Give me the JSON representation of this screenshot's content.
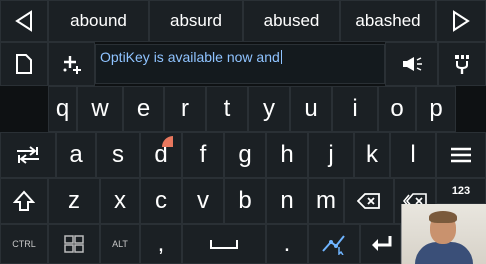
{
  "suggestions": [
    "abound",
    "absurd",
    "abused",
    "abashed"
  ],
  "scratchpad": {
    "text": "OptiKey is available now and"
  },
  "keyboard": {
    "row1": [
      "q",
      "w",
      "e",
      "r",
      "t",
      "y",
      "u",
      "i",
      "o",
      "p"
    ],
    "row2": [
      "a",
      "s",
      "d",
      "f",
      "g",
      "h",
      "j",
      "k",
      "l"
    ],
    "row3": [
      "z",
      "x",
      "c",
      "v",
      "b",
      "n",
      "m"
    ],
    "bottom": {
      "ctrl": "CTRL",
      "alt": "ALT",
      "comma": ",",
      "period": "."
    },
    "numbers_label": "123"
  },
  "icons": {
    "prev_suggestions": "triangle-left-icon",
    "next_suggestions": "triangle-right-icon",
    "new_document": "document-icon",
    "add_to_dictionary": "sparkle-plus-icon",
    "speak": "megaphone-icon",
    "calibrate": "calibrate-icon",
    "tab": "tab-icon",
    "menu": "hamburger-menu-icon",
    "shift": "shift-arrow-icon",
    "backspace": "backspace-icon",
    "backspace_word": "backspace-word-icon",
    "windows": "windows-logo-icon",
    "space": "space-bar-icon",
    "mouse": "mouse-pointer-icon",
    "enter": "enter-arrow-icon"
  },
  "colors": {
    "background": "#0e1113",
    "key": "#1b2024",
    "scratchpad_text": "#8fc3ff",
    "dwell_indicator": "#e8775e"
  }
}
